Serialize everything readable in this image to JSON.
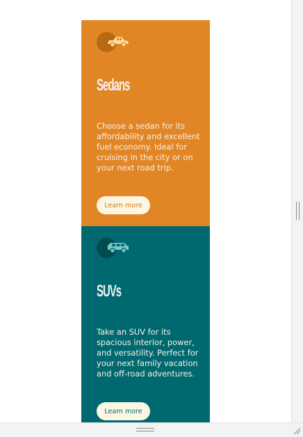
{
  "cards": [
    {
      "id": "sedans",
      "title": "Sedans",
      "description": "Choose a sedan for its affordability and excellent fuel economy. Ideal for cruising in the city or on your next road trip.",
      "button_label": "Learn more",
      "icon": "sedan-car-icon",
      "background": "#e28625"
    },
    {
      "id": "suvs",
      "title": "SUVs",
      "description": "Take an SUV for its spacious interior, power, and versatility. Perfect for your next family vacation and off-road adventures.",
      "button_label": "Learn more",
      "icon": "suv-car-icon",
      "background": "#006970"
    }
  ],
  "colors": {
    "button_background": "#fdf6e3",
    "text_light": "#f5f0e6"
  }
}
